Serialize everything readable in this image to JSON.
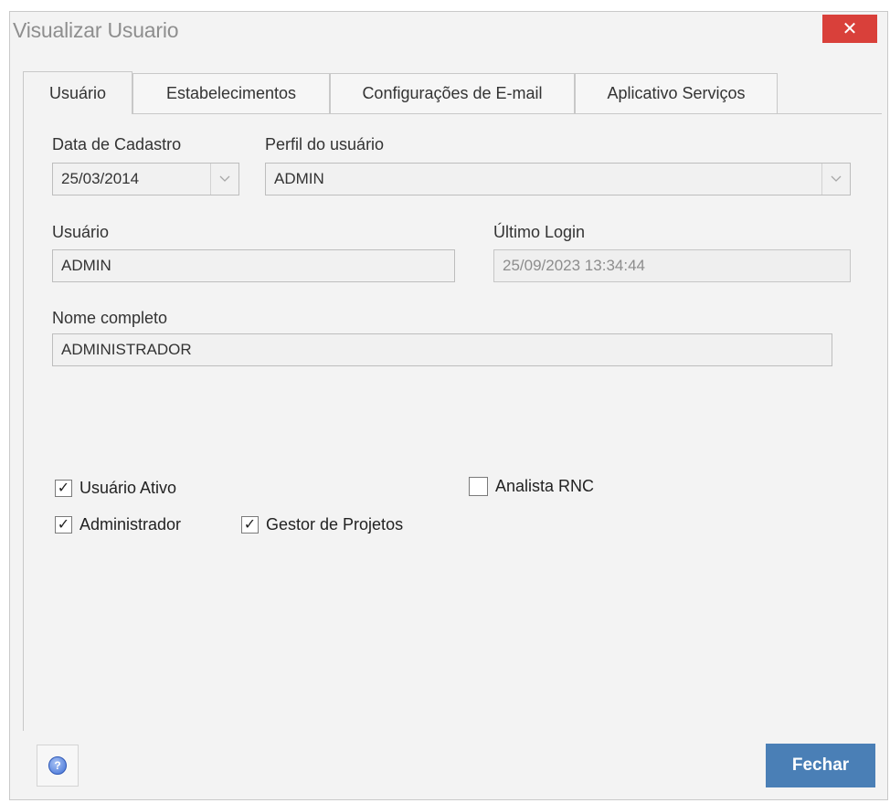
{
  "window": {
    "title": "Visualizar Usuario",
    "close_label": "✕"
  },
  "tabs": [
    {
      "label": "Usuário",
      "active": true
    },
    {
      "label": "Estabelecimentos",
      "active": false
    },
    {
      "label": "Configurações de E-mail",
      "active": false
    },
    {
      "label": "Aplicativo Serviços",
      "active": false
    }
  ],
  "form": {
    "data_cadastro": {
      "label": "Data de Cadastro",
      "value": "25/03/2014"
    },
    "perfil": {
      "label": "Perfil do usuário",
      "value": "ADMIN"
    },
    "usuario": {
      "label": "Usuário",
      "value": "ADMIN"
    },
    "ultimo_login": {
      "label": "Último Login",
      "value": "25/09/2023 13:34:44"
    },
    "nome_completo": {
      "label": "Nome completo",
      "value": "ADMINISTRADOR"
    }
  },
  "checkboxes": {
    "usuario_ativo": {
      "label": "Usuário Ativo",
      "checked": true
    },
    "analista_rnc": {
      "label": "Analista RNC",
      "checked": false
    },
    "administrador": {
      "label": "Administrador",
      "checked": true
    },
    "gestor_projetos": {
      "label": "Gestor de Projetos",
      "checked": true
    }
  },
  "footer": {
    "help_icon": "help-icon",
    "close_button_label": "Fechar"
  },
  "colors": {
    "close_button": "#d9403a",
    "primary_button": "#4a7fb6",
    "window_background": "#f3f3f3"
  }
}
